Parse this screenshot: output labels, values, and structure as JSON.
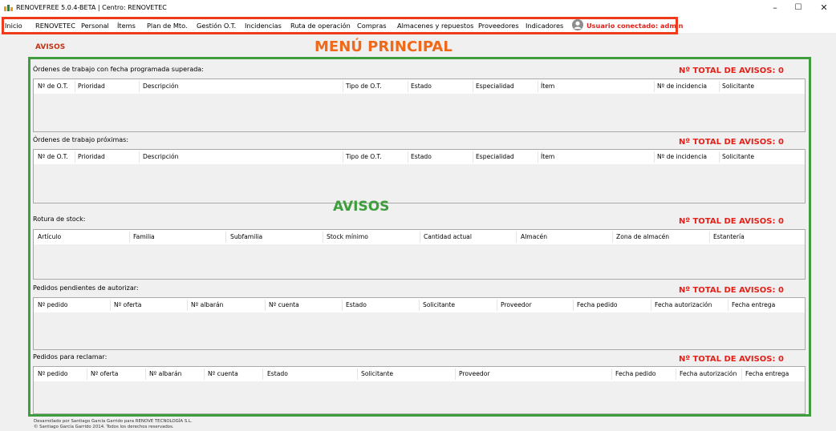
{
  "window": {
    "title": "RENOVEFREE 5.0.4-BETA | Centro: RENOVETEC",
    "minimize": "–",
    "maximize": "☐",
    "close": "✕",
    "icon": "app-logo-icon"
  },
  "menu": {
    "items": [
      "Inicio",
      "RENOVETEC",
      "Personal",
      "Ítems",
      "Plan de Mto.",
      "Gestión O.T.",
      "Incidencias",
      "Ruta de operación",
      "Compras",
      "Almacenes y repuestos",
      "Proveedores",
      "Indicadores"
    ],
    "user_label": "Usuario conectado: admin",
    "user_icon": "user-avatar-icon"
  },
  "annotations": {
    "menu_principal": "MENÚ PRINCIPAL",
    "avisos": "AVISOS"
  },
  "colors": {
    "menu_highlight": "#ee3b1a",
    "avisos_frame": "#3e9e3e",
    "total_red": "#e32119",
    "page_title": "#c23316"
  },
  "page_title": "AVISOS",
  "sections": [
    {
      "label": "Órdenes de trabajo con fecha programada superada:",
      "total": "Nº TOTAL DE AVISOS:  0",
      "columns": [
        "Nº de O.T.",
        "Prioridad",
        "Descripción",
        "Tipo de O.T.",
        "Estado",
        "Especialidad",
        "Ítem",
        "Nº de incidencia",
        "Solicitante"
      ]
    },
    {
      "label": "Órdenes de trabajo próximas:",
      "total": "Nº TOTAL DE AVISOS:  0",
      "columns": [
        "Nº de O.T.",
        "Prioridad",
        "Descripción",
        "Tipo de O.T.",
        "Estado",
        "Especialidad",
        "Ítem",
        "Nº de incidencia",
        "Solicitante"
      ]
    },
    {
      "label": "Rotura de stock:",
      "total": "Nº TOTAL DE AVISOS:  0",
      "columns": [
        "Artículo",
        "Familia",
        "Subfamilia",
        "Stock mínimo",
        "Cantidad actual",
        "Almacén",
        "Zona de almacén",
        "Estantería"
      ]
    },
    {
      "label": "Pedidos pendientes de autorizar:",
      "total": "Nº TOTAL DE AVISOS:  0",
      "columns": [
        "Nº pedido",
        "Nº oferta",
        "Nº albarán",
        "Nº cuenta",
        "Estado",
        "Solicitante",
        "Proveedor",
        "Fecha pedido",
        "Fecha autorización",
        "Fecha entrega"
      ]
    },
    {
      "label": "Pedidos para reclamar:",
      "total": "Nº TOTAL DE AVISOS:  0",
      "columns": [
        "Nº pedido",
        "Nº oferta",
        "Nº albarán",
        "Nº cuenta",
        "Estado",
        "Solicitante",
        "Proveedor",
        "Fecha pedido",
        "Fecha autorización",
        "Fecha entrega"
      ]
    }
  ],
  "footer": {
    "line1": "Desarrollado por Santiago García Garrido para RENOVE TECNOLOGÍA S.L.",
    "line2": "© Santiago García Garrido 2014. Todos los derechos reservados."
  }
}
